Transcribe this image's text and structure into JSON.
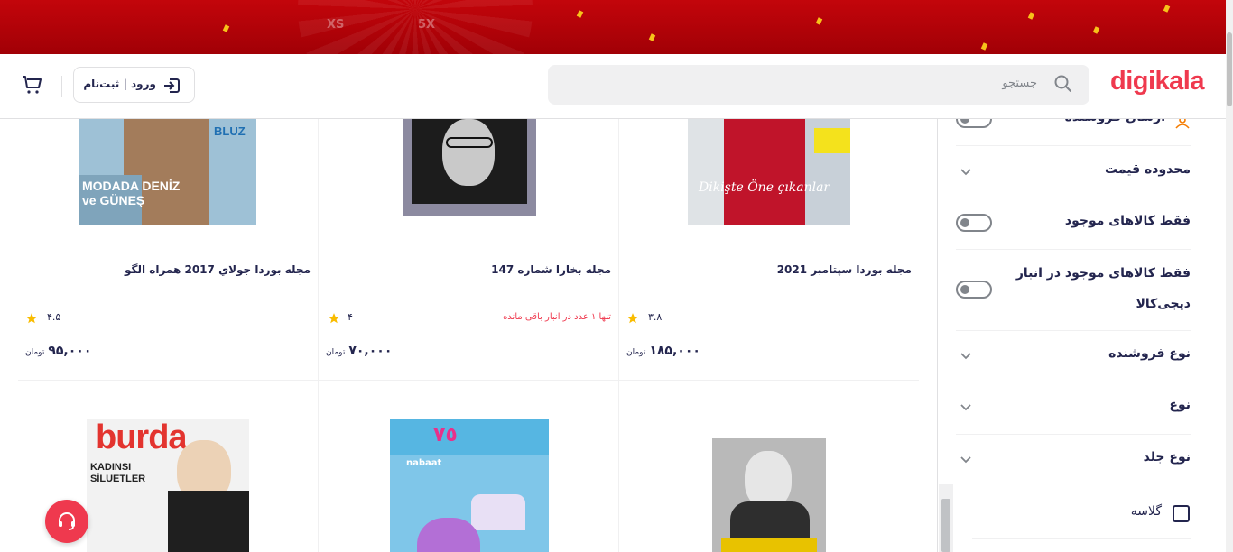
{
  "header": {
    "logo": "digikala",
    "search_placeholder": "جستجو",
    "login_label": "ورود | ثبت‌نام",
    "icons": [
      "search-icon",
      "login-icon",
      "cart-icon"
    ]
  },
  "banner": {
    "badges": [
      "XS",
      "5X"
    ]
  },
  "filters": {
    "top_partial_label": "ارسال فروشنده",
    "items": [
      {
        "label": "محدوده قیمت",
        "type": "expand"
      },
      {
        "label": "فقط کالاهای موجود",
        "type": "toggle"
      },
      {
        "label_line1": "فقط کالاهای موجود در انبار",
        "label_line2": "دیجی‌کالا",
        "type": "toggle"
      },
      {
        "label": "نوع فروشنده",
        "type": "expand"
      },
      {
        "label": "نوع",
        "type": "expand"
      },
      {
        "label": "نوع جلد",
        "type": "expand"
      }
    ],
    "cover_option": "گلاسه"
  },
  "products": [
    {
      "title": "مجله بوردا سپتامبر 2021",
      "rating": "۳.۸",
      "price": "۱۸۵,۰۰۰",
      "currency": "تومان",
      "stock_note": ""
    },
    {
      "title": "مجله بخارا شماره 147",
      "rating": "۴",
      "price": "۷۰,۰۰۰",
      "currency": "تومان",
      "stock_note": "تنها ۱ عدد در انبار باقی مانده"
    },
    {
      "title": "مجله بوردا جولاي 2017 همراه الگو",
      "rating": "۴.۵",
      "price": "۹۵,۰۰۰",
      "currency": "تومان",
      "stock_note": ""
    }
  ],
  "covers": {
    "p1_text": "Dikişte Öne çıkanlar",
    "p3_text": "MODADA DENİZ ve GÜNEŞ",
    "p3_side": "BLUZ",
    "row2_p3_logo": "burda",
    "row2_p3_text": "KADINSI SİLUETLER",
    "row2_p2_text": "nabaat"
  },
  "colors": {
    "brand": "#ef394e",
    "banner": "#c3050b",
    "text": "#23254e",
    "star": "#f9bc00"
  }
}
